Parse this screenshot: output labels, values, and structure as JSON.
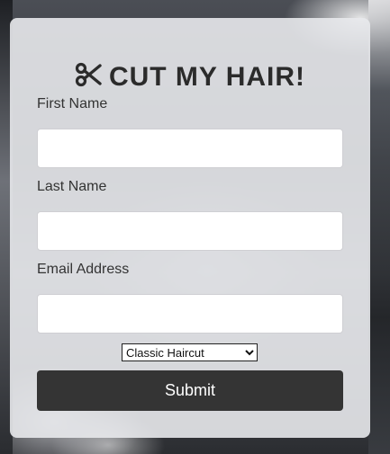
{
  "form": {
    "title": "CUT MY HAIR!",
    "title_icon": "scissors-icon",
    "first_name_label": "First Name",
    "first_name_value": "",
    "last_name_label": "Last Name",
    "last_name_value": "",
    "email_label": "Email Address",
    "email_value": "",
    "service_selected": "Classic Haircut",
    "submit_label": "Submit"
  },
  "colors": {
    "card_background": "#e8e9ec",
    "button_background": "#343434",
    "button_text": "#ffffff",
    "title_text": "#2b2b2b"
  }
}
